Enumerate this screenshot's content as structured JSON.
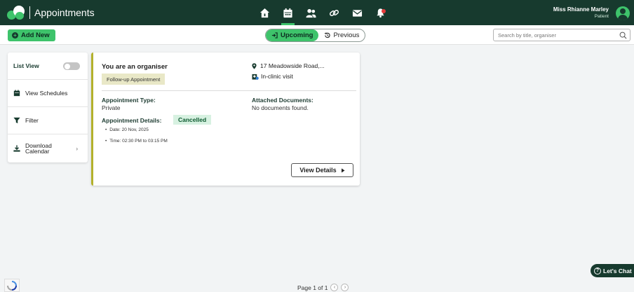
{
  "header": {
    "app_title": "Appointments",
    "nav_icons": [
      "home-icon",
      "calendar-icon",
      "users-icon",
      "link-icon",
      "mail-icon",
      "bell-icon"
    ],
    "active_nav": "calendar-icon",
    "user_name": "Miss Rhianne Marley",
    "user_role": "Patient"
  },
  "toolbar": {
    "add_new_label": "Add New",
    "upcoming_label": "Upcoming",
    "previous_label": "Previous",
    "search_placeholder": "Search by title, organiser"
  },
  "sidebar": {
    "list_view_label": "List View",
    "list_view_on": false,
    "view_schedules_label": "View Schedules",
    "filter_label": "Filter",
    "download_calendar_label_line1": "Download",
    "download_calendar_label_line2": "Calendar"
  },
  "appointment": {
    "organiser_title": "You are an organiser",
    "tag": "Follow-up Appointment",
    "location": "17 Meadowside Road,...",
    "visit_type": "In-clinic visit",
    "type_label": "Appointment Type:",
    "type_value": "Private",
    "documents_label": "Attached Documents:",
    "documents_value": "No documents found.",
    "details_label": "Appointment Details:",
    "status": "Cancelled",
    "date_line": "Date: 20 Nov, 2025",
    "time_line": "Time: 02:30 PM to 03:15 PM",
    "view_details_label": "View Details"
  },
  "footer": {
    "pagination": "Page 1 of 1",
    "chat_label": "Let's Chat"
  },
  "colors": {
    "header_bg": "#173a2e",
    "accent_green": "#3ec36b",
    "card_accent": "#b3b12c",
    "notification_dot": "#e63b3b"
  }
}
